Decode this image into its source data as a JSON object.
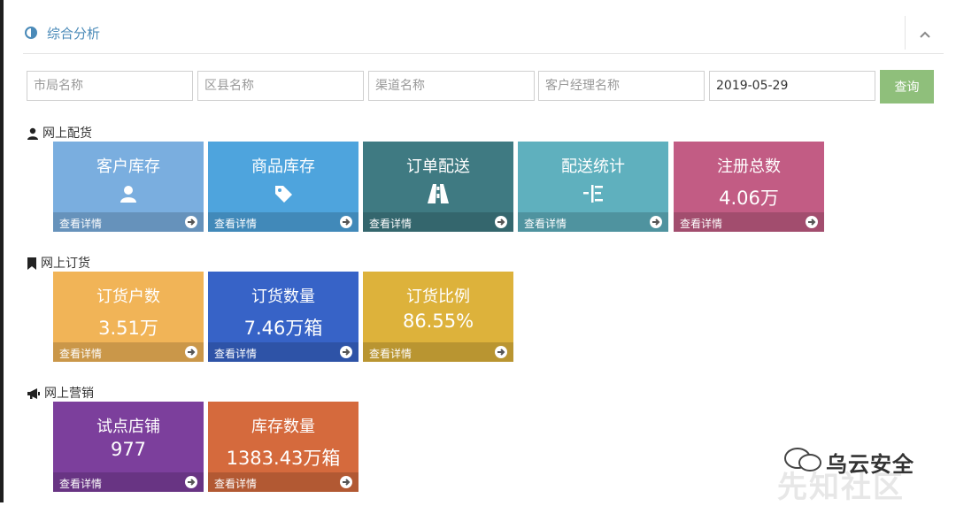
{
  "header": {
    "title": "综合分析"
  },
  "filters": [
    {
      "placeholder": "市局名称",
      "value": ""
    },
    {
      "placeholder": "区县名称",
      "value": ""
    },
    {
      "placeholder": "渠道名称",
      "value": ""
    },
    {
      "placeholder": "客户经理名称",
      "value": ""
    },
    {
      "placeholder": "",
      "value": "2019-05-29"
    }
  ],
  "query_label": "查询",
  "more_label": "查看详情",
  "sections": [
    {
      "label": "网上配货",
      "icon": "user-icon",
      "tiles": [
        {
          "title": "客户库存",
          "icon": "user-icon",
          "value": "",
          "color": "#7aaedf"
        },
        {
          "title": "商品库存",
          "icon": "tag-icon",
          "value": "",
          "color": "#4ea4dd"
        },
        {
          "title": "订单配送",
          "icon": "road-icon",
          "value": "",
          "color": "#3f7a82"
        },
        {
          "title": "配送统计",
          "icon": "indent-icon",
          "value": "",
          "color": "#5fb0be"
        },
        {
          "title": "注册总数",
          "icon": "",
          "value": "4.06万",
          "color": "#c25c84"
        }
      ]
    },
    {
      "label": "网上订货",
      "icon": "bookmark-icon",
      "tiles": [
        {
          "title": "订货户数",
          "icon": "",
          "value": "3.51万",
          "color": "#f1b457"
        },
        {
          "title": "订货数量",
          "icon": "",
          "value": "7.46万箱",
          "color": "#3763c7"
        },
        {
          "title": "订货比例",
          "icon": "",
          "value": "86.55%",
          "color": "#ddb23b"
        }
      ]
    },
    {
      "label": "网上营销",
      "icon": "bullhorn-icon",
      "tiles": [
        {
          "title": "试点店铺",
          "icon": "",
          "value": "977",
          "color": "#7c3f9c"
        },
        {
          "title": "库存数量",
          "icon": "",
          "value": "1383.43万箱",
          "color": "#d56a3d"
        }
      ]
    }
  ],
  "watermark": {
    "brand": "乌云安全",
    "faint": "先知社区"
  }
}
